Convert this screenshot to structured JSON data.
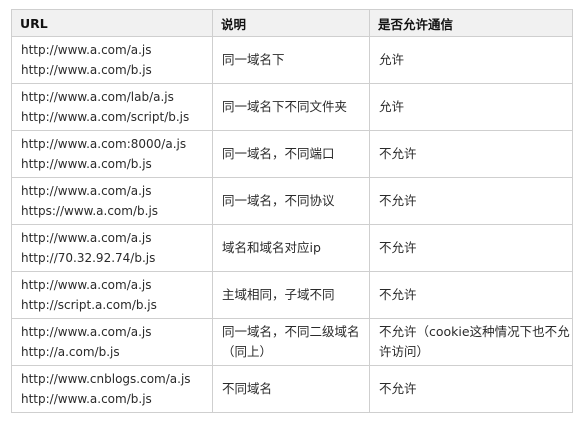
{
  "headers": [
    "URL",
    "说明",
    "是否允许通信"
  ],
  "rows": [
    {
      "urls": [
        "http://www.a.com/a.js",
        "http://www.a.com/b.js"
      ],
      "desc": "同一域名下",
      "allow": "允许"
    },
    {
      "urls": [
        "http://www.a.com/lab/a.js",
        "http://www.a.com/script/b.js"
      ],
      "desc": "同一域名下不同文件夹",
      "allow": "允许"
    },
    {
      "urls": [
        "http://www.a.com:8000/a.js",
        "http://www.a.com/b.js"
      ],
      "desc": "同一域名，不同端口",
      "allow": "不允许"
    },
    {
      "urls": [
        "http://www.a.com/a.js",
        "https://www.a.com/b.js"
      ],
      "desc": "同一域名，不同协议",
      "allow": "不允许"
    },
    {
      "urls": [
        "http://www.a.com/a.js",
        "http://70.32.92.74/b.js"
      ],
      "desc": "域名和域名对应ip",
      "allow": "不允许"
    },
    {
      "urls": [
        "http://www.a.com/a.js",
        "http://script.a.com/b.js"
      ],
      "desc": "主域相同，子域不同",
      "allow": "不允许"
    },
    {
      "urls": [
        "http://www.a.com/a.js",
        "http://a.com/b.js"
      ],
      "desc": "同一域名，不同二级域名（同上）",
      "allow": "不允许（cookie这种情况下也不允许访问）"
    },
    {
      "urls": [
        "http://www.cnblogs.com/a.js",
        "http://www.a.com/b.js"
      ],
      "desc": "不同域名",
      "allow": "不允许"
    }
  ]
}
